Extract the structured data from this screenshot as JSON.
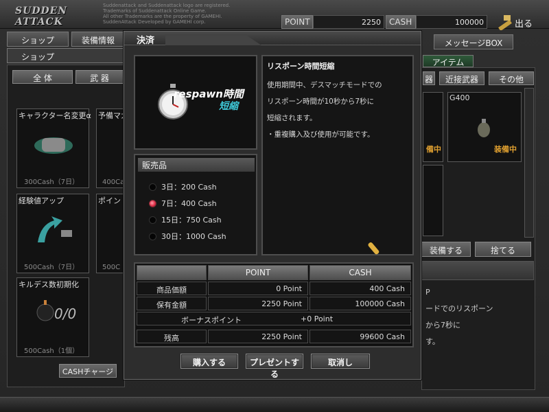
{
  "header": {
    "logo_text": "SUDDEN ATTACK",
    "copyright_lines": [
      "Suddenattack and Suddenattack logo are registered.",
      "Trademarks of Suddenattack Online Game.",
      "All other Trademarks are the property of GAMEHI.",
      "SuddenAttack Developed by GAMEHI corp."
    ],
    "point_label": "POINT",
    "point_value": "2250",
    "cash_label": "CASH",
    "cash_value": "100000",
    "exit_label": "出る"
  },
  "main_tabs": [
    {
      "label": "ショップ"
    },
    {
      "label": "装備情報"
    }
  ],
  "sub_tab": "ショップ",
  "category_tabs": [
    {
      "label": "全 体"
    },
    {
      "label": "武 器"
    }
  ],
  "shop_items": [
    {
      "name": "キャラクター名変更α",
      "price": "300Cash（7日）"
    },
    {
      "name": "予備マガ",
      "price": "400Ca"
    },
    {
      "name": "経験値アップ",
      "price": "500Cash（7日）"
    },
    {
      "name": "ポイント",
      "price": "500C"
    },
    {
      "name": "キルデス数初期化",
      "price": "500Cash（1個）"
    }
  ],
  "cash_charge_label": "CASHチャージ",
  "right_panel": {
    "message_box_tab": "メッセージBOX",
    "item_tab": "アイテム",
    "filters": [
      "器",
      "近接武器",
      "その他"
    ],
    "inventory_item_name": "G400",
    "equipped_label": "装備中",
    "equipped_label_2": "備中",
    "equip_button": "装備する",
    "discard_button": "捨てる",
    "desc_fragments": [
      "P",
      "ードでのリスポーン",
      "から7秒に",
      "す。"
    ]
  },
  "dialog": {
    "title": "決済",
    "item_logo_main": "respawn時間",
    "item_logo_sub": "短縮",
    "item_name": "リスポーン時間短縮",
    "description_lines": [
      "使用期間中、デスマッチモードでの",
      "リスポーン時間が10秒から7秒に",
      "短縮されます。",
      "・重複購入及び使用が可能です。"
    ],
    "sale_header": "販売品",
    "options": [
      {
        "label": "3日：200 Cash",
        "selected": false
      },
      {
        "label": "7日：400 Cash",
        "selected": true
      },
      {
        "label": "15日：750 Cash",
        "selected": false
      },
      {
        "label": "30日：1000 Cash",
        "selected": false
      }
    ],
    "table": {
      "col_point": "POINT",
      "col_cash": "CASH",
      "rows": [
        {
          "label": "商品価額",
          "point": "0 Point",
          "cash": "400 Cash"
        },
        {
          "label": "保有金額",
          "point": "2250 Point",
          "cash": "100000 Cash"
        }
      ],
      "bonus_label": "ボーナスポイント",
      "bonus_value": "+0 Point",
      "balance_label": "残高",
      "balance_point": "2250 Point",
      "balance_cash": "99600 Cash"
    },
    "buy_button": "購入する",
    "present_button": "プレゼントする",
    "cancel_button": "取消し"
  },
  "colors": {
    "accent_green": "#2f5a3a",
    "selected_radio": "#e0304a",
    "equipped_text": "#e0a030"
  }
}
